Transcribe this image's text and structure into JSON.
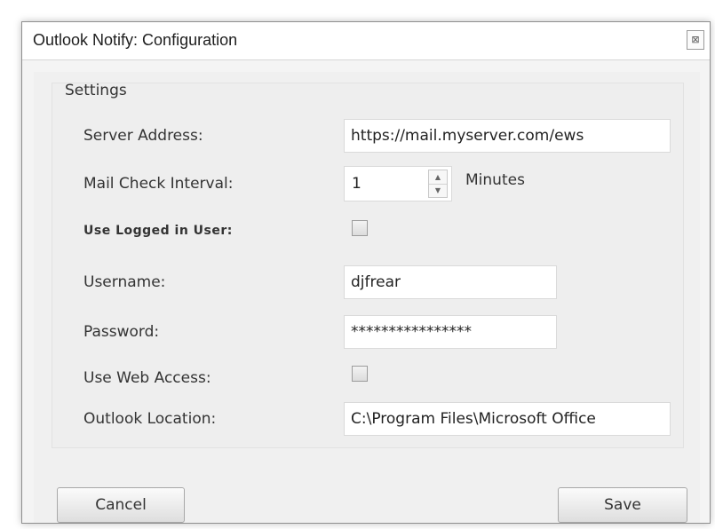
{
  "window": {
    "title": "Outlook Notify: Configuration",
    "close_glyph": "⊠"
  },
  "settings": {
    "group_label": "Settings",
    "server_address": {
      "label": "Server Address:",
      "value": "https://mail.myserver.com/ews"
    },
    "mail_check_interval": {
      "label": "Mail Check Interval:",
      "value": "1",
      "unit": "Minutes"
    },
    "use_logged_in_user": {
      "label": "Use Logged in User:",
      "checked": false
    },
    "username": {
      "label": "Username:",
      "value": "djfrear"
    },
    "password": {
      "label": "Password:",
      "value": "****************"
    },
    "use_web_access": {
      "label": "Use Web Access:",
      "checked": false
    },
    "outlook_location": {
      "label": "Outlook Location:",
      "value": "C:\\Program Files\\Microsoft Office"
    }
  },
  "buttons": {
    "cancel": "Cancel",
    "save": "Save"
  },
  "icons": {
    "close": "close-icon",
    "spin_up": "chevron-up-icon",
    "spin_down": "chevron-down-icon"
  }
}
